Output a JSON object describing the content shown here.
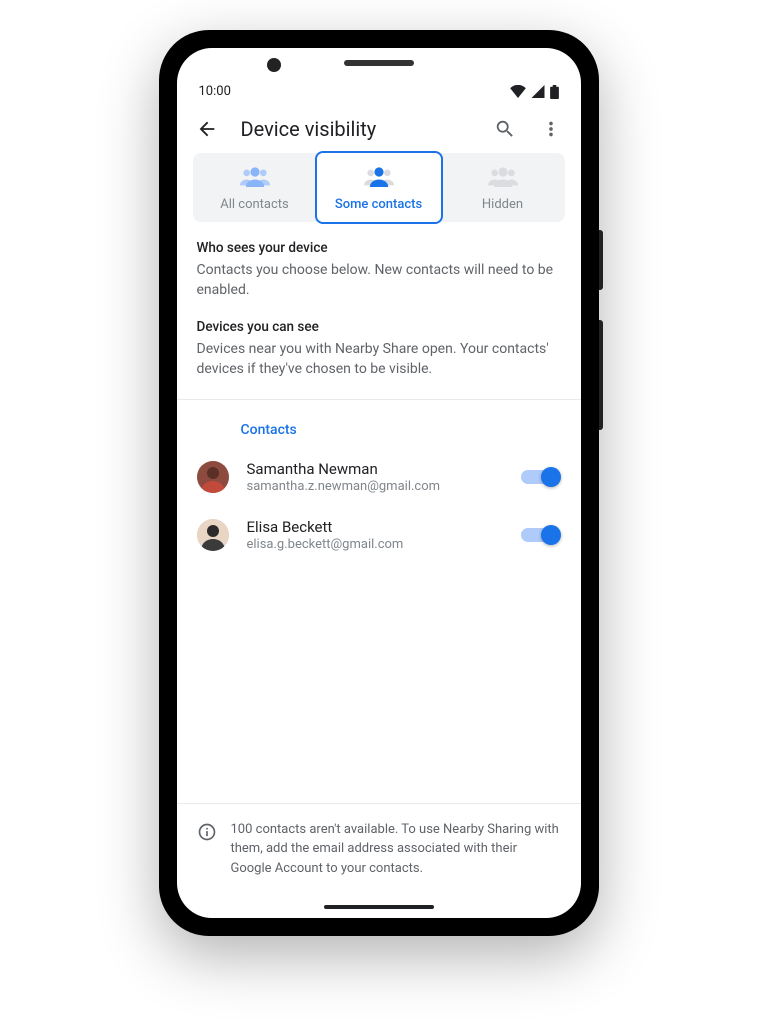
{
  "status_bar": {
    "time": "10:00"
  },
  "app_bar": {
    "title": "Device visibility"
  },
  "tabs": {
    "all": "All contacts",
    "some": "Some contacts",
    "hidden": "Hidden"
  },
  "sections": {
    "who_sees_title": "Who sees your device",
    "who_sees_text": "Contacts you choose below. New contacts will need to be enabled.",
    "you_see_title": "Devices you can see",
    "you_see_text": "Devices near you with Nearby Share open. Your contacts' devices if they've chosen to be visible."
  },
  "contacts": {
    "header": "Contacts",
    "items": [
      {
        "name": "Samantha Newman",
        "email": "samantha.z.newman@gmail.com",
        "enabled": true
      },
      {
        "name": "Elisa Beckett",
        "email": "elisa.g.beckett@gmail.com",
        "enabled": true
      }
    ]
  },
  "footer": {
    "text": "100 contacts aren't available. To use Nearby Sharing with them, add the email address associated with their Google Account to your contacts."
  },
  "colors": {
    "accent": "#1a73e8",
    "text_primary": "#202124",
    "text_secondary": "#5f6368"
  }
}
